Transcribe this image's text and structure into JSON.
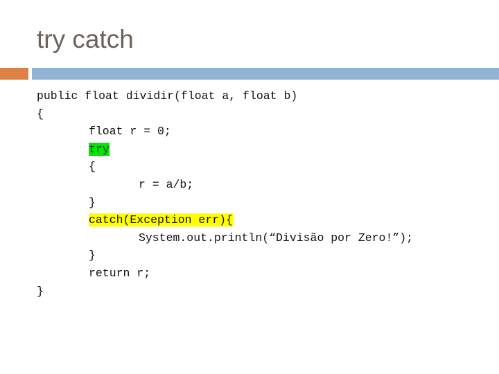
{
  "slide": {
    "title": "try catch",
    "background_color": "#ffffff",
    "title_color": "#6d605a",
    "accent_color": "#dd8247",
    "bar_color": "#92b4d4",
    "highlight_green": "#00e800",
    "highlight_yellow": "#ffff00"
  },
  "code": {
    "language": "java",
    "lines": [
      {
        "indent": 0,
        "text": "public float dividir(float a, float b)",
        "highlight": "none"
      },
      {
        "indent": 0,
        "text": "{",
        "highlight": "none"
      },
      {
        "indent": 1,
        "text": "float r = 0;",
        "highlight": "none"
      },
      {
        "indent": 1,
        "text": "try",
        "highlight": "green"
      },
      {
        "indent": 1,
        "text": "{",
        "highlight": "none"
      },
      {
        "indent": 2,
        "text": "r = a/b;",
        "highlight": "none"
      },
      {
        "indent": 1,
        "text": "}",
        "highlight": "none"
      },
      {
        "indent": 1,
        "text": "catch(Exception err){",
        "highlight": "yellow"
      },
      {
        "indent": 2,
        "text": "System.out.println(“Divisão por Zero!”);",
        "highlight": "none"
      },
      {
        "indent": 1,
        "text": "}",
        "highlight": "none"
      },
      {
        "indent": 1,
        "text": "return r;",
        "highlight": "none"
      },
      {
        "indent": 0,
        "text": "}",
        "highlight": "none"
      }
    ]
  }
}
